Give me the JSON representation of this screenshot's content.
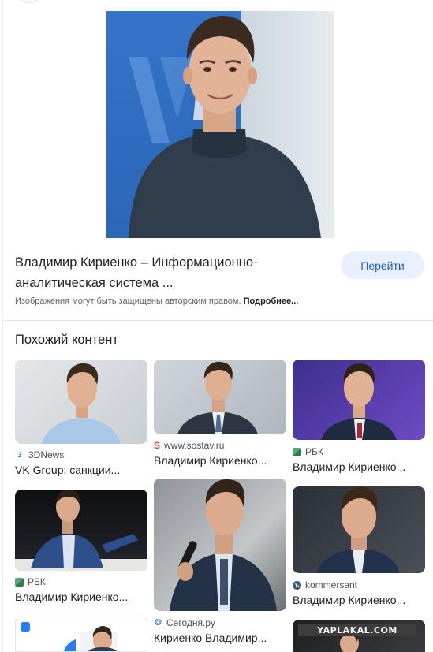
{
  "result": {
    "title_line1": "Владимир Кириенко – Информационно-",
    "title_line2": "аналитическая система ...",
    "go_label": "Перейти",
    "copyright_text": "Изображения могут быть защищены авторским правом.",
    "copyright_more": "Подробнее..."
  },
  "similar": {
    "heading": "Похожий контент",
    "items": [
      {
        "source": "3DNews",
        "caption": "VK Group: санкции...",
        "favicon": "3dnews-favicon"
      },
      {
        "source": "www.sostav.ru",
        "caption": "Владимир Кириенко...",
        "favicon": "sostav-favicon"
      },
      {
        "source": "РБК",
        "caption": "Владимир Кириенко...",
        "favicon": "rbc-favicon"
      },
      {
        "source": "РБК",
        "caption": "Владимир Кириенко...",
        "favicon": "rbc-favicon"
      },
      {
        "source": "Сегодня.ру",
        "caption": "Кириенко Владимир...",
        "favicon": "segodnya-favicon"
      },
      {
        "source": "kommersant",
        "caption": "Владимир Кириенко...",
        "favicon": "kommersant-favicon"
      }
    ]
  },
  "watermark": "YAPLAKAL.COM",
  "colors": {
    "accent_button_bg": "#e8f0fe",
    "accent_button_text": "#1a5fc2",
    "vk_blue": "#2c66b6"
  }
}
